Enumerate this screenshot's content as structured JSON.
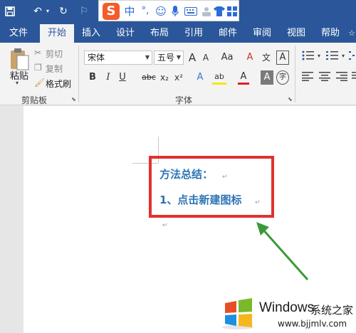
{
  "quick_access": [
    "save-icon",
    "undo-icon",
    "redo-icon",
    "format-painter-icon",
    "customize-icon"
  ],
  "ime_toolbar": {
    "logo": "S",
    "mode": "中",
    "punct": "°,",
    "icons": [
      "emoji-icon",
      "voice-icon",
      "keyboard-icon",
      "toolbox-icon",
      "skin-icon",
      "apps-icon"
    ]
  },
  "tabs": [
    "文件",
    "开始",
    "插入",
    "设计",
    "布局",
    "引用",
    "邮件",
    "审阅",
    "视图",
    "帮助"
  ],
  "active_tab": "开始",
  "clipboard": {
    "paste_label": "粘贴",
    "cut_label": "剪切",
    "copy_label": "复制",
    "format_painter_label": "格式刷",
    "group_label": "剪贴板"
  },
  "font": {
    "name": "宋体",
    "size": "五号",
    "grow": "A",
    "shrink": "A",
    "case": "Aa",
    "clear": "A",
    "phonetic": "文",
    "char_border": "A",
    "bold": "B",
    "italic": "I",
    "underline": "U",
    "strike": "abc",
    "subscript": "x₂",
    "superscript": "x²",
    "text_effect": "A",
    "highlight": "ab",
    "font_color": "A",
    "char_shading": "A",
    "enclose": "字",
    "group_label": "字体"
  },
  "document": {
    "line1": "方法总结：",
    "line2": "1、点击新建图标"
  },
  "watermark": {
    "brand": "Windows",
    "cn": "系统之家",
    "url": "www.bjjmlv.com"
  },
  "colors": {
    "ribbon_blue": "#2b579a",
    "text_blue": "#2e74b5",
    "annotation_red": "#e0322e",
    "arrow_green": "#3a9a3a"
  }
}
